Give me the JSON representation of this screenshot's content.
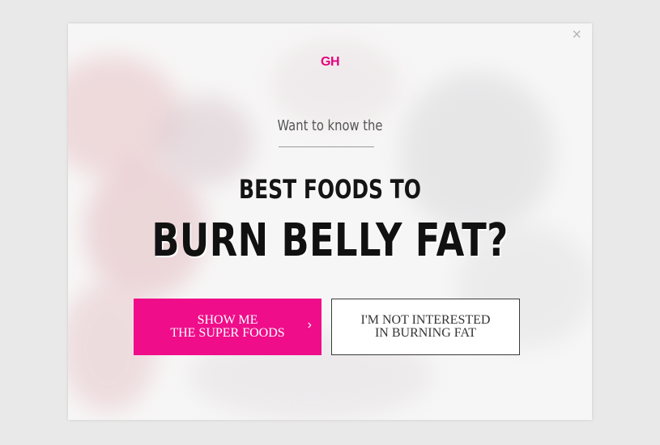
{
  "popup": {
    "logo": "GH",
    "close_glyph": "×",
    "intro": "Want to know the",
    "headline_line1": "BEST FOODS TO",
    "headline_line2": "BURN BELLY FAT?",
    "accept_button": {
      "line1": "SHOW ME",
      "line2": "THE SUPER FOODS",
      "chevron": "›"
    },
    "decline_button": {
      "line1": "I'M NOT INTERESTED",
      "line2": "IN BURNING FAT"
    },
    "icons": {
      "close": "close-icon",
      "chevron": "chevron-right-icon"
    },
    "colors": {
      "accent": "#ef0d8a",
      "logo": "#e5007d",
      "headline": "#111111"
    }
  }
}
